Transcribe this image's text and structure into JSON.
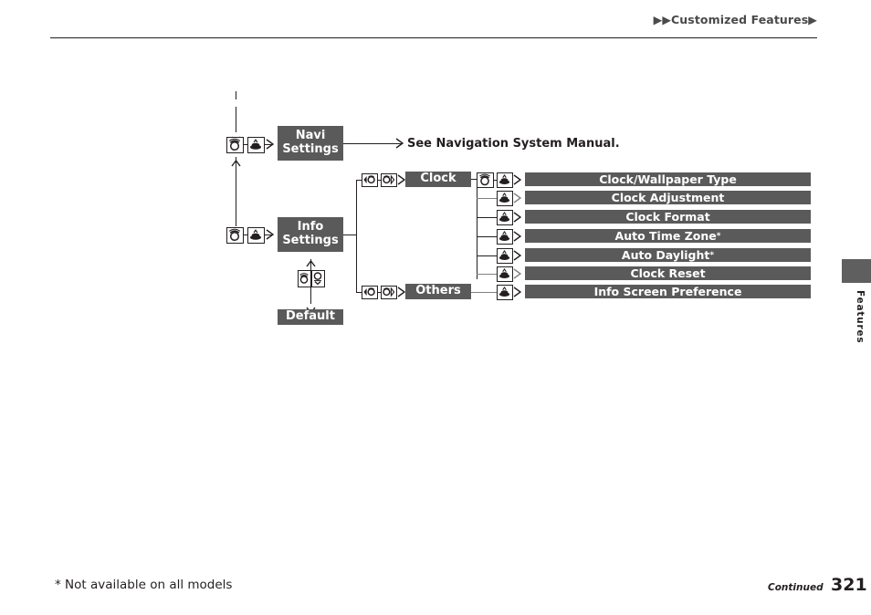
{
  "header": {
    "title": "▶▶Customized Features▶"
  },
  "side_tab": {
    "label": "Features"
  },
  "footer": {
    "footnote": "* Not available on all models",
    "continued": "Continued",
    "page_number": "321"
  },
  "colors": {
    "box_gray": "#5a5a5a",
    "tab_gray": "#5f5f5f",
    "line_black": "#231f20",
    "line_gray": "#808080",
    "text_white": "#ffffff"
  },
  "diagram": {
    "nodes": {
      "navi_settings": {
        "line1": "Navi",
        "line2": "Settings"
      },
      "info_settings": {
        "line1": "Info",
        "line2": "Settings"
      },
      "default": {
        "label": "Default"
      },
      "clock": {
        "label": "Clock"
      },
      "others": {
        "label": "Others"
      }
    },
    "navi_note": "See Navigation System Manual.",
    "clock_items": [
      {
        "label": "Clock/Wallpaper Type",
        "footnote": false
      },
      {
        "label": "Clock Adjustment",
        "footnote": false
      },
      {
        "label": "Clock Format",
        "footnote": false
      },
      {
        "label": "Auto Time Zone",
        "footnote": true
      },
      {
        "label": "Auto Daylight",
        "footnote": true
      },
      {
        "label": "Clock Reset",
        "footnote": false
      }
    ],
    "others_items": [
      {
        "label": "Info Screen Preference",
        "footnote": false
      }
    ],
    "icons": {
      "dial": "dial-knob-icon",
      "press": "press-button-icon",
      "dial_left": "dial-left-arrow-icon",
      "dial_right": "dial-right-arrow-icon",
      "dial_down": "dial-down-arrow-icon"
    }
  }
}
